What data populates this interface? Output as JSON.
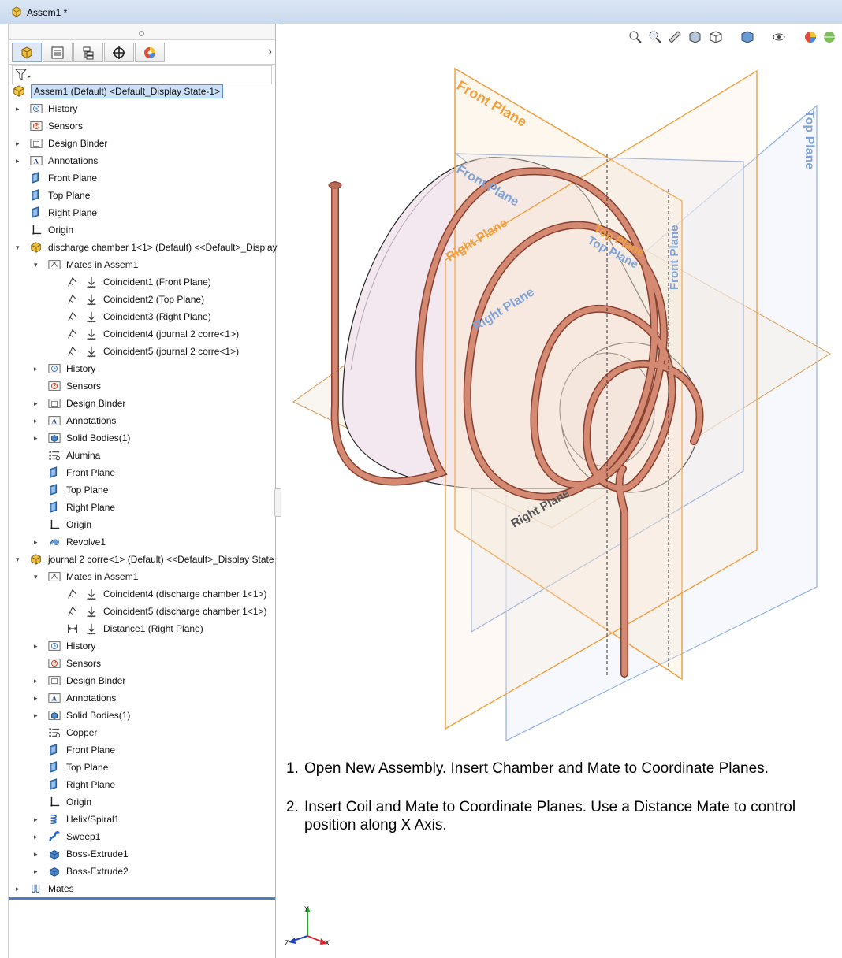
{
  "window": {
    "title": "Assem1 *"
  },
  "tabs": [
    {
      "name": "feature-manager",
      "icon": "feature-manager-icon"
    },
    {
      "name": "property-manager",
      "icon": "property-manager-icon"
    },
    {
      "name": "configuration-manager",
      "icon": "configuration-manager-icon"
    },
    {
      "name": "dimxpert-manager",
      "icon": "dimxpert-icon"
    },
    {
      "name": "display-manager",
      "icon": "display-manager-icon"
    }
  ],
  "tree": [
    {
      "label": "Assem1 (Default) <Default_Display State-1>",
      "icon": "assembly-icon",
      "level": 0,
      "arrow": ""
    },
    {
      "label": "History",
      "icon": "history-icon",
      "level": 1,
      "arrow": "right"
    },
    {
      "label": "Sensors",
      "icon": "sensors-icon",
      "level": 1,
      "arrow": ""
    },
    {
      "label": "Design Binder",
      "icon": "design-binder-icon",
      "level": 1,
      "arrow": "right"
    },
    {
      "label": "Annotations",
      "icon": "annotations-icon",
      "level": 1,
      "arrow": "right"
    },
    {
      "label": "Front Plane",
      "icon": "plane-icon",
      "level": 1,
      "arrow": ""
    },
    {
      "label": "Top Plane",
      "icon": "plane-icon",
      "level": 1,
      "arrow": ""
    },
    {
      "label": "Right Plane",
      "icon": "plane-icon",
      "level": 1,
      "arrow": ""
    },
    {
      "label": "Origin",
      "icon": "origin-icon",
      "level": 1,
      "arrow": ""
    },
    {
      "label": "discharge chamber 1<1> (Default) <<Default>_Display",
      "icon": "part-icon",
      "level": 1,
      "arrow": "down"
    },
    {
      "label": "Mates in Assem1",
      "icon": "mates-folder-icon",
      "level": 2,
      "arrow": "down"
    },
    {
      "label": "Coincident1 (Front Plane)",
      "icon": "coincident-mate-icon",
      "level": 3,
      "arrow": ""
    },
    {
      "label": "Coincident2 (Top Plane)",
      "icon": "coincident-mate-icon",
      "level": 3,
      "arrow": ""
    },
    {
      "label": "Coincident3 (Right Plane)",
      "icon": "coincident-mate-icon",
      "level": 3,
      "arrow": ""
    },
    {
      "label": "Coincident4 (journal 2 corre<1>)",
      "icon": "coincident-mate-icon",
      "level": 3,
      "arrow": ""
    },
    {
      "label": "Coincident5 (journal 2 corre<1>)",
      "icon": "coincident-mate-icon",
      "level": 3,
      "arrow": ""
    },
    {
      "label": "History",
      "icon": "history-icon",
      "level": 2,
      "arrow": "right"
    },
    {
      "label": "Sensors",
      "icon": "sensors-icon",
      "level": 2,
      "arrow": ""
    },
    {
      "label": "Design Binder",
      "icon": "design-binder-icon",
      "level": 2,
      "arrow": "right"
    },
    {
      "label": "Annotations",
      "icon": "annotations-icon",
      "level": 2,
      "arrow": "right"
    },
    {
      "label": "Solid Bodies(1)",
      "icon": "solid-bodies-icon",
      "level": 2,
      "arrow": "right"
    },
    {
      "label": "Alumina",
      "icon": "material-icon",
      "level": 2,
      "arrow": ""
    },
    {
      "label": "Front Plane",
      "icon": "plane-icon",
      "level": 2,
      "arrow": ""
    },
    {
      "label": "Top Plane",
      "icon": "plane-icon",
      "level": 2,
      "arrow": ""
    },
    {
      "label": "Right Plane",
      "icon": "plane-icon",
      "level": 2,
      "arrow": ""
    },
    {
      "label": "Origin",
      "icon": "origin-icon",
      "level": 2,
      "arrow": ""
    },
    {
      "label": "Revolve1",
      "icon": "revolve-icon",
      "level": 2,
      "arrow": "right"
    },
    {
      "label": "journal 2 corre<1> (Default) <<Default>_Display State",
      "icon": "part-icon",
      "level": 1,
      "arrow": "down"
    },
    {
      "label": "Mates in Assem1",
      "icon": "mates-folder-icon",
      "level": 2,
      "arrow": "down"
    },
    {
      "label": "Coincident4 (discharge chamber 1<1>)",
      "icon": "coincident-mate-icon",
      "level": 3,
      "arrow": ""
    },
    {
      "label": "Coincident5 (discharge chamber 1<1>)",
      "icon": "coincident-mate-icon",
      "level": 3,
      "arrow": ""
    },
    {
      "label": "Distance1 (Right Plane)",
      "icon": "distance-mate-icon",
      "level": 3,
      "arrow": ""
    },
    {
      "label": "History",
      "icon": "history-icon",
      "level": 2,
      "arrow": "right"
    },
    {
      "label": "Sensors",
      "icon": "sensors-icon",
      "level": 2,
      "arrow": ""
    },
    {
      "label": "Design Binder",
      "icon": "design-binder-icon",
      "level": 2,
      "arrow": "right"
    },
    {
      "label": "Annotations",
      "icon": "annotations-icon",
      "level": 2,
      "arrow": "right"
    },
    {
      "label": "Solid Bodies(1)",
      "icon": "solid-bodies-icon",
      "level": 2,
      "arrow": "right"
    },
    {
      "label": "Copper",
      "icon": "material-icon",
      "level": 2,
      "arrow": ""
    },
    {
      "label": "Front Plane",
      "icon": "plane-icon",
      "level": 2,
      "arrow": ""
    },
    {
      "label": "Top Plane",
      "icon": "plane-icon",
      "level": 2,
      "arrow": ""
    },
    {
      "label": "Right Plane",
      "icon": "plane-icon",
      "level": 2,
      "arrow": ""
    },
    {
      "label": "Origin",
      "icon": "origin-icon",
      "level": 2,
      "arrow": ""
    },
    {
      "label": "Helix/Spiral1",
      "icon": "helix-icon",
      "level": 2,
      "arrow": "right"
    },
    {
      "label": "Sweep1",
      "icon": "sweep-icon",
      "level": 2,
      "arrow": "right"
    },
    {
      "label": "Boss-Extrude1",
      "icon": "extrude-icon",
      "level": 2,
      "arrow": "right"
    },
    {
      "label": "Boss-Extrude2",
      "icon": "extrude-icon",
      "level": 2,
      "arrow": "right"
    },
    {
      "label": "Mates",
      "icon": "mates-icon",
      "level": 0,
      "arrow": "right"
    }
  ],
  "viewport": {
    "toolbar": [
      "zoom-to-fit-icon",
      "zoom-to-area-icon",
      "previous-view-icon",
      "section-view-icon",
      "view-orientation-icon",
      "display-style-icon",
      "hide-show-items-icon",
      "edit-appearance-icon",
      "apply-scene-icon"
    ],
    "plane_labels": {
      "coil_front": "Front Plane",
      "coil_top": "Top Plane",
      "coil_right": "Right Plane",
      "chamber_front": "Front Plane",
      "chamber_top": "Top Plane",
      "chamber_right": "Right Plane",
      "asm_top": "Top Plane",
      "asm_right": "Right Plane",
      "asm_front": "Front Plane"
    },
    "colors": {
      "coil_plane": "#f0a040",
      "chamber_plane": "#7fa2d8",
      "copper": "#c8735e",
      "chamber_body": "#f1e6ee"
    }
  },
  "instructions": [
    {
      "num": "1.",
      "text": "Open New Assembly.  Insert Chamber and Mate to Coordinate Planes."
    },
    {
      "num": "2.",
      "text": "Insert Coil and Mate to Coordinate Planes.  Use a Distance Mate to control position along X Axis."
    }
  ],
  "triad": {
    "x": "X",
    "y": "Y",
    "z": "Z"
  }
}
